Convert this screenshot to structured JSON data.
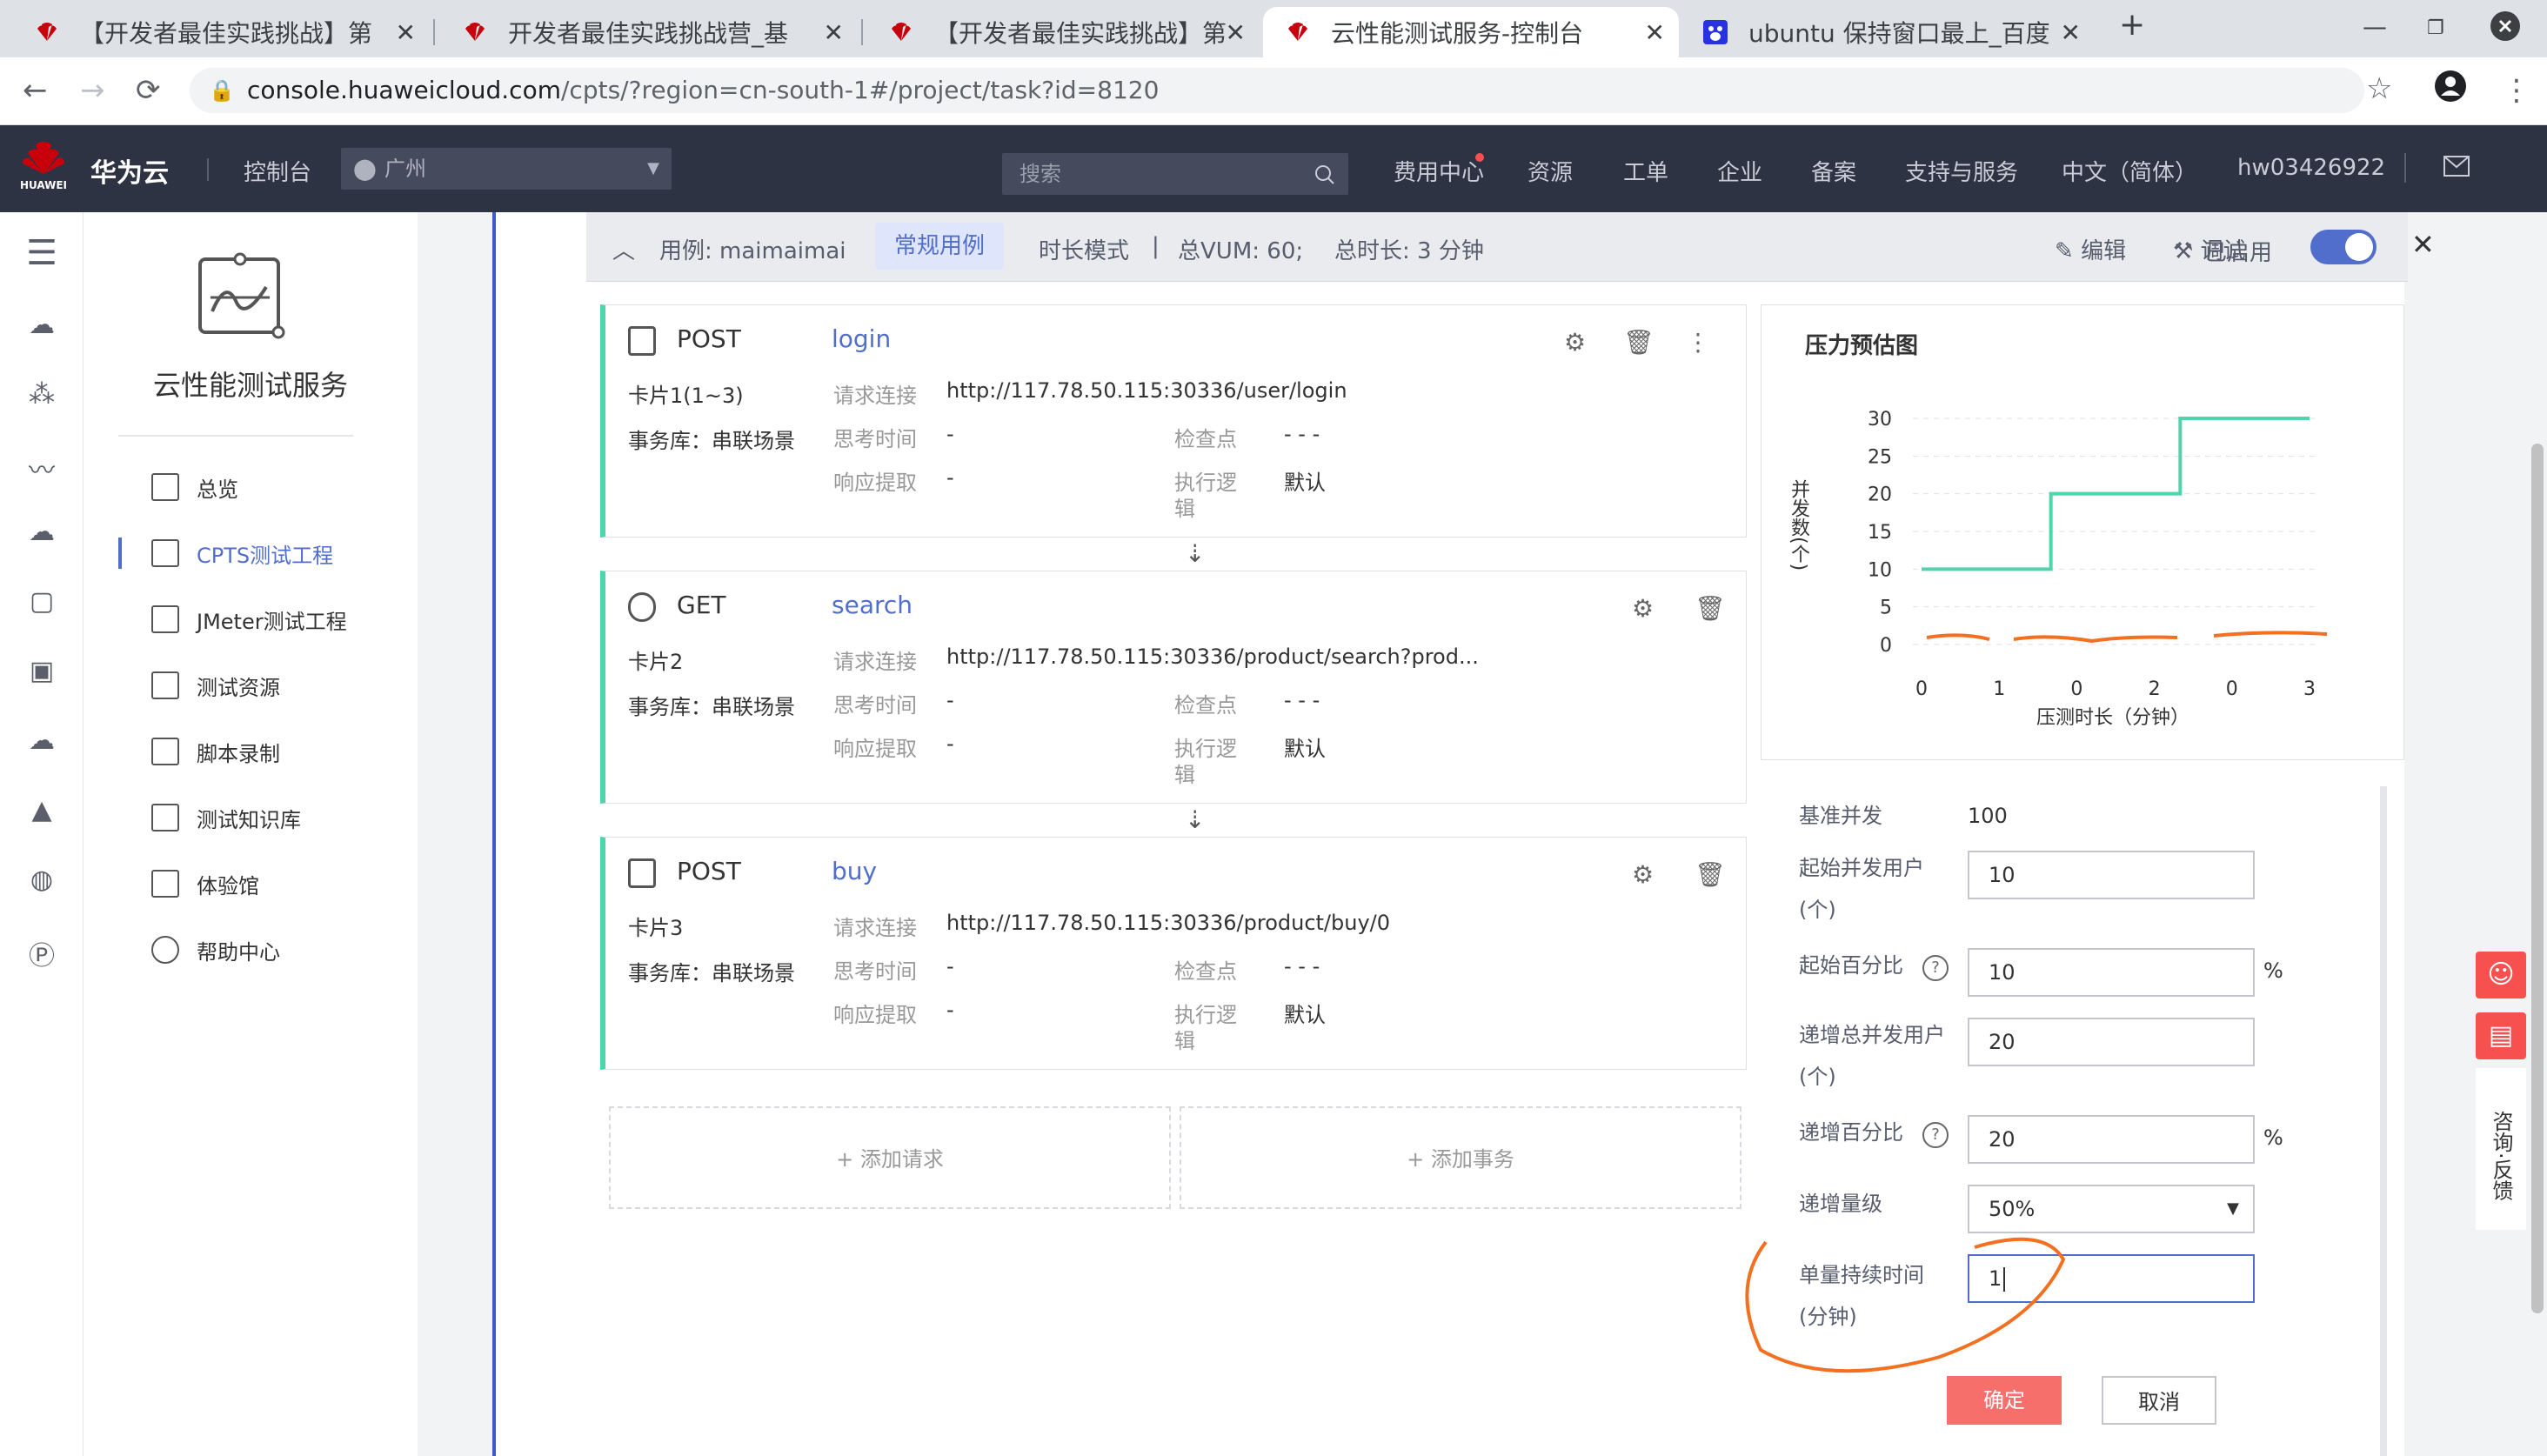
{
  "browser": {
    "tabs": [
      {
        "title": "【开发者最佳实践挑战】第",
        "active": false
      },
      {
        "title": "开发者最佳实践挑战营_基",
        "active": false
      },
      {
        "title": "【开发者最佳实践挑战】第",
        "active": false
      },
      {
        "title": "云性能测试服务-控制台",
        "active": true
      },
      {
        "title": "ubuntu 保持窗口最上_百度",
        "active": false
      }
    ],
    "new_tab": "+",
    "url_host": "console.huaweicloud.com",
    "url_path": "/cpts/?region=cn-south-1#/project/task?id=8120"
  },
  "topnav": {
    "logo_text": "HUAWEI",
    "brand": "华为云",
    "console": "控制台",
    "region": "广州",
    "search_placeholder": "搜索",
    "links": [
      "费用中心",
      "资源",
      "工单",
      "企业",
      "备案",
      "支持与服务",
      "中文（简体）",
      "hw03426922"
    ]
  },
  "sidebar": {
    "title": "云性能测试服务",
    "items": [
      {
        "label": "总览"
      },
      {
        "label": "CPTS测试工程",
        "active": true
      },
      {
        "label": "JMeter测试工程"
      },
      {
        "label": "测试资源"
      },
      {
        "label": "脚本录制"
      },
      {
        "label": "测试知识库"
      },
      {
        "label": "体验馆"
      },
      {
        "label": "帮助中心"
      }
    ]
  },
  "case_bar": {
    "case": "用例: maimaimai",
    "type_tag": "常规用例",
    "mode": "时长模式",
    "sep": "|",
    "vum": "总VUM: 60;",
    "duration": "总时长: 3 分钟",
    "edit": "编辑",
    "debug": "调试",
    "enabled": "已启用"
  },
  "field_labels": {
    "url": "请求连接",
    "think": "思考时间",
    "extract": "响应提取",
    "check": "检查点",
    "logic_1": "执行逻",
    "logic_2": "辑"
  },
  "requests": [
    {
      "method": "POST",
      "name": "login",
      "card": "卡片1(1~3)",
      "db": "事务库：串联场景",
      "url": "http://117.78.50.115:30336/user/login",
      "think": "-",
      "extract": "-",
      "check": "- - -",
      "logic": "默认"
    },
    {
      "method": "GET",
      "name": "search",
      "card": "卡片2",
      "db": "事务库：串联场景",
      "url": "http://117.78.50.115:30336/product/search?prod...",
      "think": "-",
      "extract": "-",
      "check": "- - -",
      "logic": "默认"
    },
    {
      "method": "POST",
      "name": "buy",
      "card": "卡片3",
      "db": "事务库：串联场景",
      "url": "http://117.78.50.115:30336/product/buy/0",
      "think": "-",
      "extract": "-",
      "check": "- - -",
      "logic": "默认"
    }
  ],
  "add": {
    "request": "+ 添加请求",
    "transaction": "+ 添加事务"
  },
  "chart_data": {
    "type": "line",
    "title": "压力预估图",
    "xlabel": "压测时长（分钟）",
    "ylabel": "并发数(个)",
    "x_ticks": [
      "0",
      "1",
      "0",
      "2",
      "0",
      "3"
    ],
    "y_ticks": [
      0,
      5,
      10,
      15,
      20,
      25,
      30
    ],
    "ylim": [
      0,
      30
    ],
    "series": [
      {
        "color": "#50d4ab",
        "points": [
          [
            0,
            10
          ],
          [
            1,
            10
          ],
          [
            1,
            20
          ],
          [
            2,
            20
          ],
          [
            2,
            30
          ],
          [
            3,
            30
          ]
        ]
      }
    ],
    "grid": true
  },
  "form": {
    "base_label": "基准并发",
    "base_value": "100",
    "start_users_label": "起始并发用户",
    "start_users_unit": "(个)",
    "start_users": "10",
    "start_pct_label": "起始百分比",
    "start_pct": "10",
    "inc_users_label": "递增总并发用户",
    "inc_users_unit": "(个)",
    "inc_users": "20",
    "inc_pct_label": "递增百分比",
    "inc_pct": "20",
    "level_label": "递增量级",
    "level": "50%",
    "duration_label": "单量持续时间",
    "duration_unit": "(分钟)",
    "duration": "1",
    "percent": "%",
    "confirm": "确定",
    "cancel": "取消"
  },
  "float": {
    "feedback": "咨询·反馈"
  },
  "colors": {
    "accent": "#526ecc",
    "green": "#50d4ab",
    "orange": "#f37021",
    "danger": "#f6514f"
  }
}
